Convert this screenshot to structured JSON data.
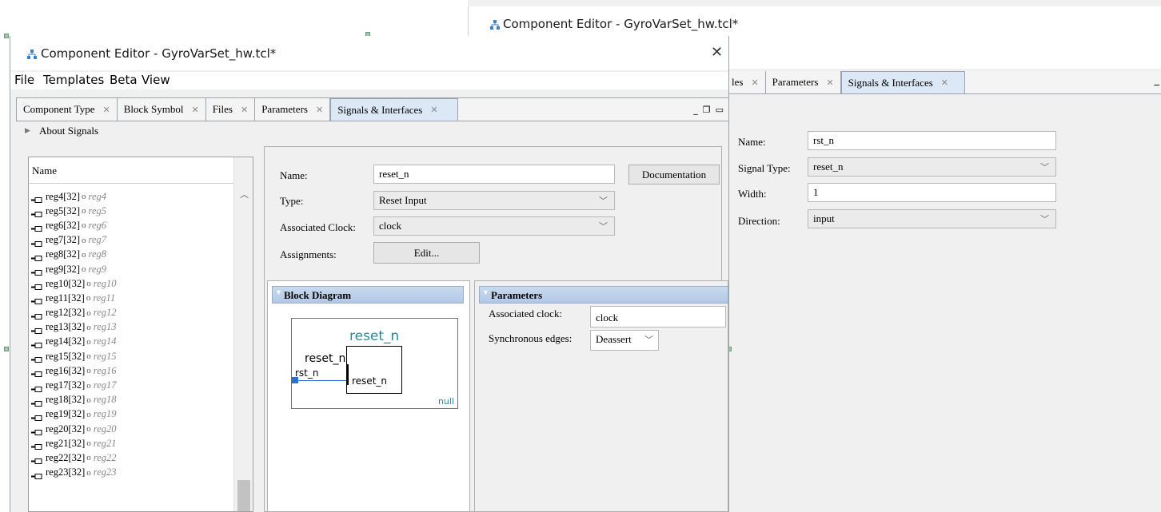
{
  "back_window": {
    "title": "Component Editor - GyroVarSet_hw.tcl*",
    "tabs": [
      {
        "label": "les",
        "closable": true
      },
      {
        "label": "Parameters",
        "closable": true
      },
      {
        "label": "Signals & Interfaces",
        "closable": true,
        "active": true
      }
    ],
    "form": {
      "name_label": "Name:",
      "name_value": "rst_n",
      "signal_type_label": "Signal Type:",
      "signal_type_value": "reset_n",
      "width_label": "Width:",
      "width_value": "1",
      "direction_label": "Direction:",
      "direction_value": "input"
    }
  },
  "front_window": {
    "title": "Component Editor - GyroVarSet_hw.tcl*",
    "menu": [
      "File",
      "Templates",
      "Beta",
      "View"
    ],
    "tabs": [
      {
        "label": "Component Type",
        "closable": true
      },
      {
        "label": "Block Symbol",
        "closable": true
      },
      {
        "label": "Files",
        "closable": true
      },
      {
        "label": "Parameters",
        "closable": true
      },
      {
        "label": "Signals & Interfaces",
        "closable": true,
        "active": true
      }
    ],
    "about_signals": "About Signals",
    "signal_list": {
      "header": "Name",
      "items": [
        {
          "name": "reg4[32]",
          "alias": "reg4"
        },
        {
          "name": "reg5[32]",
          "alias": "reg5"
        },
        {
          "name": "reg6[32]",
          "alias": "reg6"
        },
        {
          "name": "reg7[32]",
          "alias": "reg7"
        },
        {
          "name": "reg8[32]",
          "alias": "reg8"
        },
        {
          "name": "reg9[32]",
          "alias": "reg9"
        },
        {
          "name": "reg10[32]",
          "alias": "reg10"
        },
        {
          "name": "reg11[32]",
          "alias": "reg11"
        },
        {
          "name": "reg12[32]",
          "alias": "reg12"
        },
        {
          "name": "reg13[32]",
          "alias": "reg13"
        },
        {
          "name": "reg14[32]",
          "alias": "reg14"
        },
        {
          "name": "reg15[32]",
          "alias": "reg15"
        },
        {
          "name": "reg16[32]",
          "alias": "reg16"
        },
        {
          "name": "reg17[32]",
          "alias": "reg17"
        },
        {
          "name": "reg18[32]",
          "alias": "reg18"
        },
        {
          "name": "reg19[32]",
          "alias": "reg19"
        },
        {
          "name": "reg20[32]",
          "alias": "reg20"
        },
        {
          "name": "reg21[32]",
          "alias": "reg21"
        },
        {
          "name": "reg22[32]",
          "alias": "reg22"
        },
        {
          "name": "reg23[32]",
          "alias": "reg23"
        }
      ]
    },
    "form": {
      "name_label": "Name:",
      "name_value": "reset_n",
      "documentation_button": "Documentation",
      "type_label": "Type:",
      "type_value": "Reset Input",
      "clock_label": "Associated Clock:",
      "clock_value": "clock",
      "assignments_label": "Assignments:",
      "edit_button": "Edit..."
    },
    "block_diagram": {
      "title": "Block Diagram",
      "interface_name": "reset_n",
      "group_label": "reset_n",
      "port_label": "rst_n",
      "box_label": "reset_n",
      "null_label": "null"
    },
    "parameters": {
      "title": "Parameters",
      "assoc_clock_label": "Associated clock:",
      "assoc_clock_value": "clock",
      "sync_edges_label": "Synchronous edges:",
      "sync_edges_value": "Deassert"
    }
  },
  "colors": {
    "tab_active": "#dce8f5",
    "section_header": "#b8cce8",
    "teal_text": "#2a8a9a",
    "port_blue": "#2a6fd6"
  }
}
